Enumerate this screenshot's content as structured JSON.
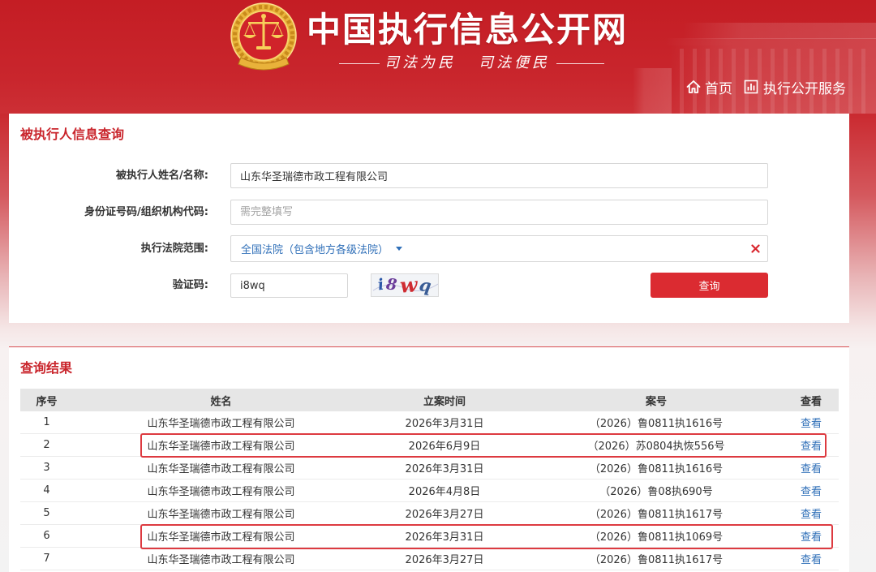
{
  "site": {
    "title": "中国执行信息公开网",
    "slogan": [
      "司法为民",
      "司法便民"
    ],
    "emblem_icon": "court-emblem-icon"
  },
  "nav": {
    "items": [
      {
        "label": "首页",
        "icon": "home-icon"
      },
      {
        "label": "执行公开服务",
        "icon": "bar-chart-icon"
      }
    ]
  },
  "query_form": {
    "title": "被执行人信息查询",
    "name_label": "被执行人姓名/名称:",
    "name_value": "山东华圣瑞德市政工程有限公司",
    "id_label": "身份证号码/组织机构代码:",
    "id_placeholder": "需完整填写",
    "court_label": "执行法院范围:",
    "court_value": "全国法院（包含地方各级法院）",
    "court_dropdown_icon": "caret-down-icon",
    "court_clear_icon": "close-icon",
    "captcha_label": "验证码:",
    "captcha_value": "i8wq",
    "captcha_image_text": [
      "i",
      "8",
      "w",
      "q"
    ],
    "submit_label": "查询"
  },
  "results": {
    "title": "查询结果",
    "columns": [
      "序号",
      "姓名",
      "立案时间",
      "案号",
      "查看"
    ],
    "rows": [
      {
        "index": 1,
        "name": "山东华圣瑞德市政工程有限公司",
        "filing_date": "2026年3月31日",
        "case_no": "（2026）鲁0811执1616号",
        "view": "查看",
        "highlighted": false
      },
      {
        "index": 2,
        "name": "山东华圣瑞德市政工程有限公司",
        "filing_date": "2026年6月9日",
        "case_no": "（2026）苏0804执恢556号",
        "view": "查看",
        "highlighted": true
      },
      {
        "index": 3,
        "name": "山东华圣瑞德市政工程有限公司",
        "filing_date": "2026年3月31日",
        "case_no": "（2026）鲁0811执1616号",
        "view": "查看",
        "highlighted": false
      },
      {
        "index": 4,
        "name": "山东华圣瑞德市政工程有限公司",
        "filing_date": "2026年4月8日",
        "case_no": "（2026）鲁08执690号",
        "view": "查看",
        "highlighted": false
      },
      {
        "index": 5,
        "name": "山东华圣瑞德市政工程有限公司",
        "filing_date": "2026年3月27日",
        "case_no": "（2026）鲁0811执1617号",
        "view": "查看",
        "highlighted": false
      },
      {
        "index": 6,
        "name": "山东华圣瑞德市政工程有限公司",
        "filing_date": "2026年3月31日",
        "case_no": "（2026）鲁0811执1069号",
        "view": "查看",
        "highlighted": true
      },
      {
        "index": 7,
        "name": "山东华圣瑞德市政工程有限公司",
        "filing_date": "2026年3月27日",
        "case_no": "（2026）鲁0811执1617号",
        "view": "查看",
        "highlighted": false
      }
    ]
  },
  "colors": {
    "brand_red": "#c8232a",
    "title_red": "#c9242b",
    "button_red": "#db2b31",
    "link_blue": "#2f6fb8",
    "highlight_red": "#dd3a40"
  }
}
